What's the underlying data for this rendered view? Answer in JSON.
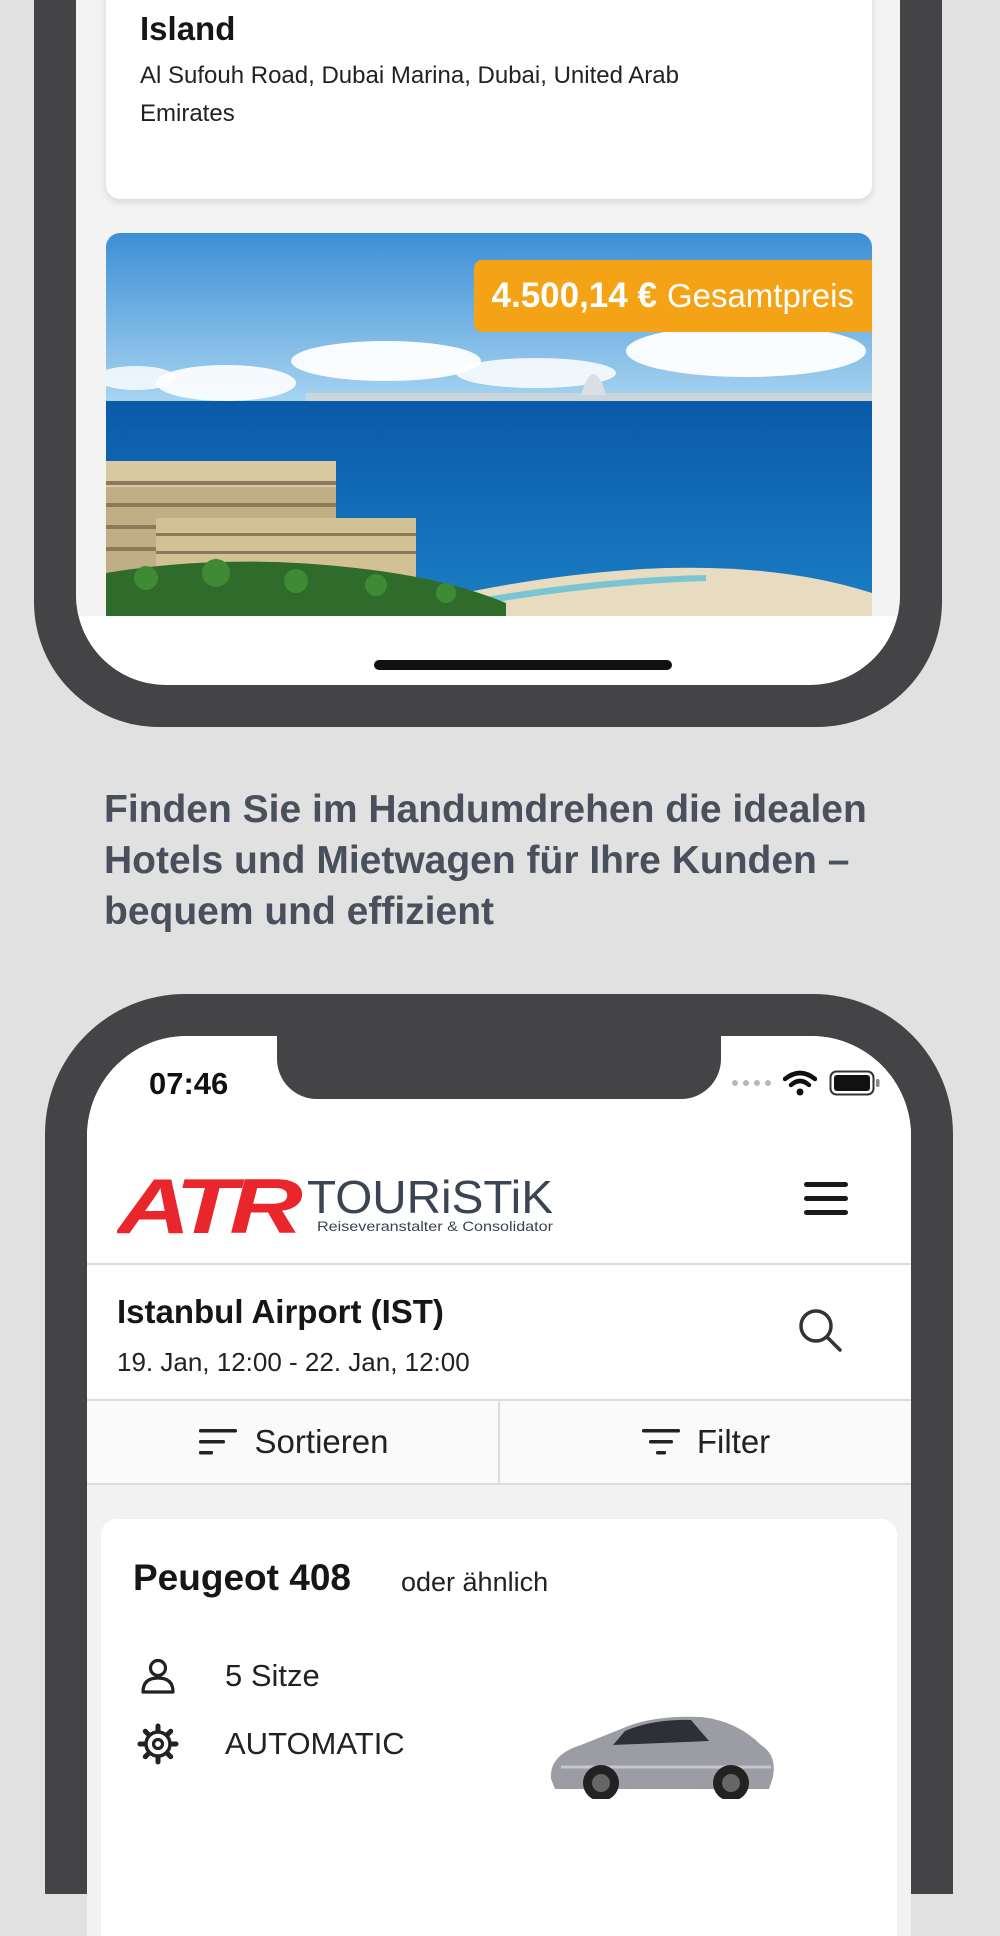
{
  "top_phone": {
    "hotel": {
      "name": "Island",
      "address": "Al Sufouh Road, Dubai Marina, Dubai, United Arab Emirates"
    },
    "price": {
      "amount": "4.500,14 €",
      "label": "Gesamtpreis"
    }
  },
  "caption": "Finden Sie im Handumdrehen die idealen Hotels und Mietwagen für Ihre Kunden – bequem und effizient",
  "bottom_phone": {
    "status_bar": {
      "time": "07:46"
    },
    "header": {
      "logo_brand": "ATR",
      "logo_name": "TOURiSTiK",
      "logo_tagline": "Reiseveranstalter & Consolidator"
    },
    "search": {
      "location": "Istanbul Airport (IST)",
      "dates": "19. Jan, 12:00 - 22. Jan, 12:00"
    },
    "toolbar": {
      "sort_label": "Sortieren",
      "filter_label": "Filter"
    },
    "car": {
      "model": "Peugeot 408",
      "similar": "oder ähnlich",
      "seats": "5 Sitze",
      "transmission": "AUTOMATIC"
    }
  },
  "colors": {
    "price_badge": "#f4a216",
    "brand_red": "#e8262b",
    "phone_frame": "#444446",
    "caption_text": "#4a4f5c"
  },
  "icons": [
    "menu-icon",
    "search-icon",
    "sort-icon",
    "filter-icon",
    "person-icon",
    "gear-icon",
    "wifi-icon",
    "battery-icon"
  ]
}
